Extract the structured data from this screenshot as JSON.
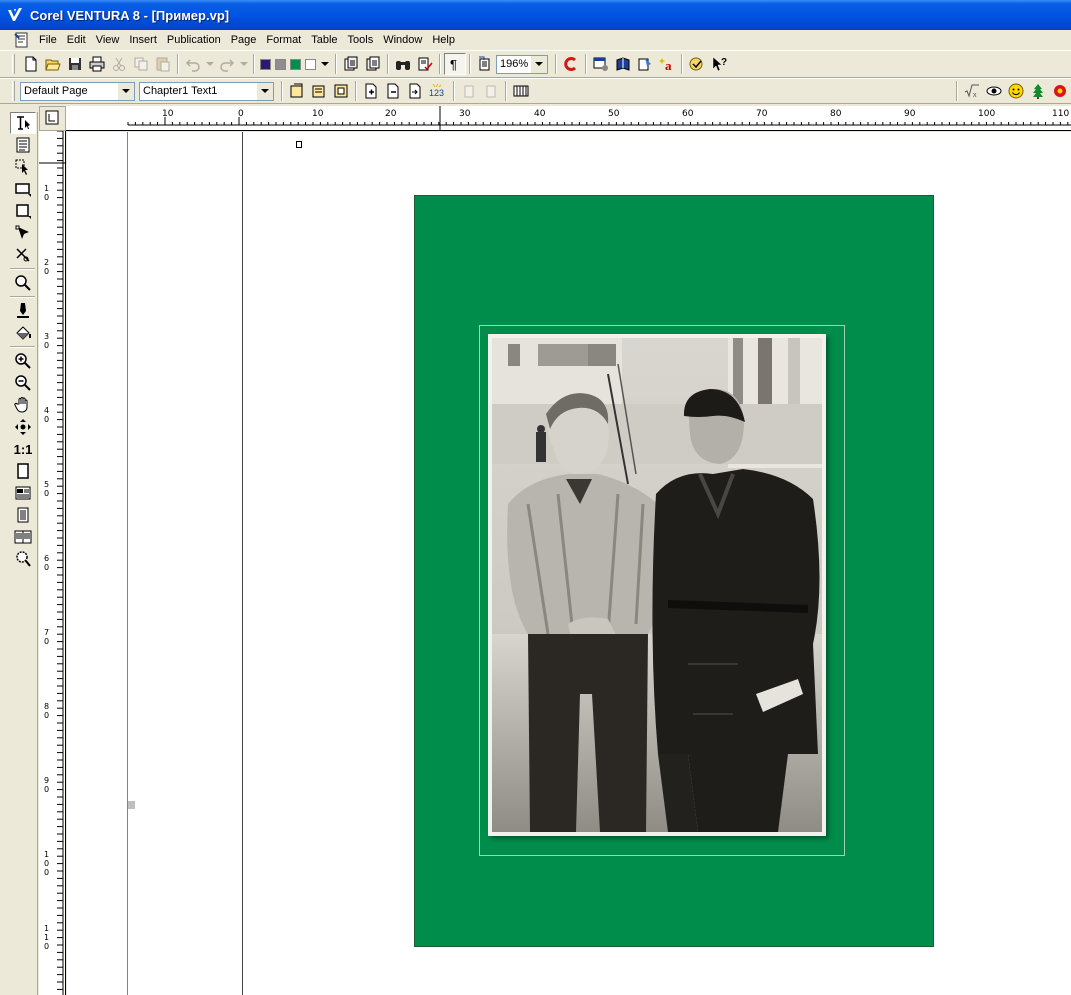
{
  "window": {
    "title": "Corel VENTURA 8 - [Пример.vp]"
  },
  "menu": [
    {
      "label": "File"
    },
    {
      "label": "Edit"
    },
    {
      "label": "View"
    },
    {
      "label": "Insert"
    },
    {
      "label": "Publication"
    },
    {
      "label": "Page"
    },
    {
      "label": "Format"
    },
    {
      "label": "Table"
    },
    {
      "label": "Tools"
    },
    {
      "label": "Window"
    },
    {
      "label": "Help"
    }
  ],
  "toolbar": {
    "zoom_value": "196%",
    "swatch_colors": [
      "#2b1a6e",
      "#8e8e8e",
      "#009049",
      "#ffffff"
    ]
  },
  "formatbar": {
    "page_tag": "Default Page",
    "paragraph_tag": "Chapter1 Text1",
    "page_number_badge": "123"
  },
  "toolbox": {
    "actual_size_label": "1:1"
  },
  "rulers": {
    "horizontal": [
      "10",
      "0",
      "10",
      "20",
      "30",
      "40",
      "50",
      "60",
      "70",
      "80",
      "90",
      "100",
      "110"
    ],
    "vertical": [
      "1 0",
      "2 0",
      "3 0",
      "4 0",
      "5 0",
      "6 0",
      "7 0",
      "8 0",
      "9 0",
      "1 0 0",
      "1 1 0"
    ]
  },
  "document": {
    "page_background": "#008d4c",
    "photo_description_alt": "black and white photograph"
  }
}
